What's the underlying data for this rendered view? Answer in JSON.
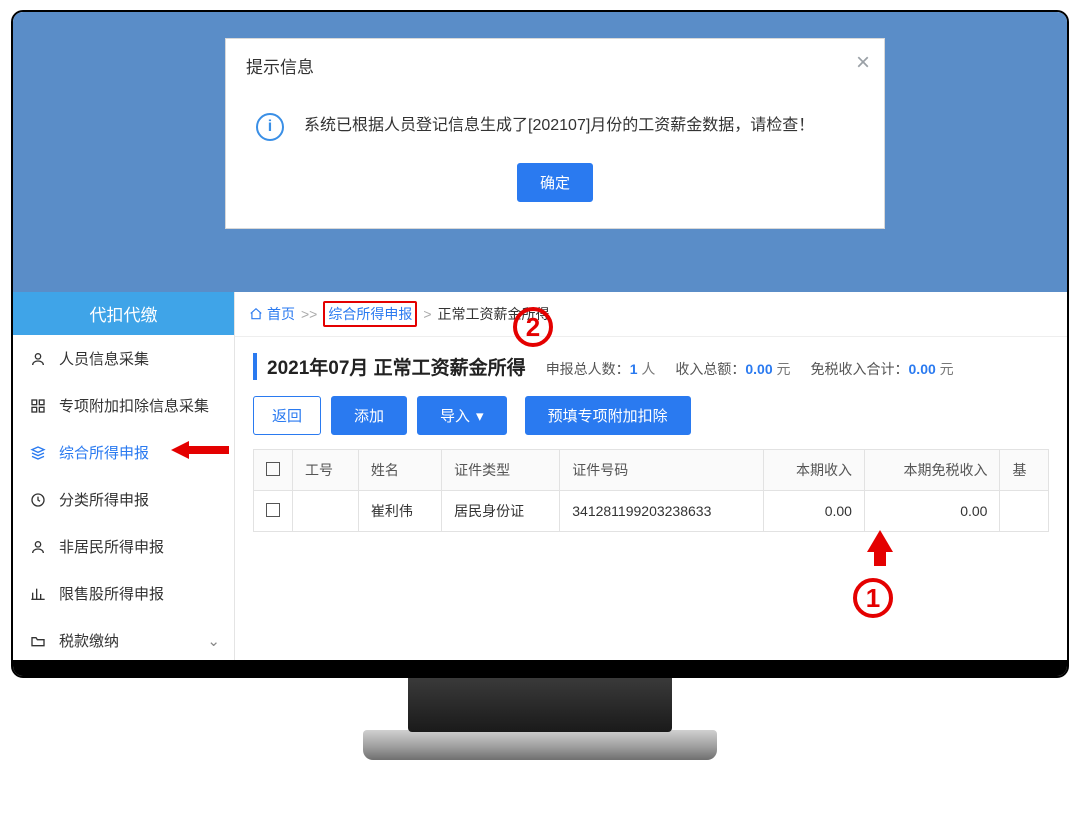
{
  "modal": {
    "title": "提示信息",
    "message": "系统已根据人员登记信息生成了[202107]月份的工资薪金数据，请检查！",
    "confirm": "确定"
  },
  "sidebar": {
    "title": "代扣代缴",
    "items": [
      {
        "label": "人员信息采集"
      },
      {
        "label": "专项附加扣除信息采集"
      },
      {
        "label": "综合所得申报"
      },
      {
        "label": "分类所得申报"
      },
      {
        "label": "非居民所得申报"
      },
      {
        "label": "限售股所得申报"
      },
      {
        "label": "税款缴纳"
      }
    ]
  },
  "breadcrumb": {
    "home": "首页",
    "link": "综合所得申报",
    "current": "正常工资薪金所得"
  },
  "page": {
    "title": "2021年07月 正常工资薪金所得",
    "stat_people_label": "申报总人数：",
    "stat_people_value": "1",
    "stat_people_unit": "人",
    "stat_income_label": "收入总额：",
    "stat_income_value": "0.00",
    "stat_income_unit": "元",
    "stat_taxfree_label": "免税收入合计：",
    "stat_taxfree_value": "0.00",
    "stat_taxfree_unit": "元"
  },
  "toolbar": {
    "back": "返回",
    "add": "添加",
    "import": "导入",
    "prefill": "预填专项附加扣除"
  },
  "table": {
    "headers": {
      "empno": "工号",
      "name": "姓名",
      "idtype": "证件类型",
      "idno": "证件号码",
      "income": "本期收入",
      "taxfree": "本期免税收入",
      "base": "基"
    },
    "rows": [
      {
        "empno": "",
        "name": "崔利伟",
        "idtype": "居民身份证",
        "idno": "341281199203238633",
        "income": "0.00",
        "taxfree": "0.00"
      }
    ]
  },
  "annotations": {
    "one": "1",
    "two": "2"
  }
}
